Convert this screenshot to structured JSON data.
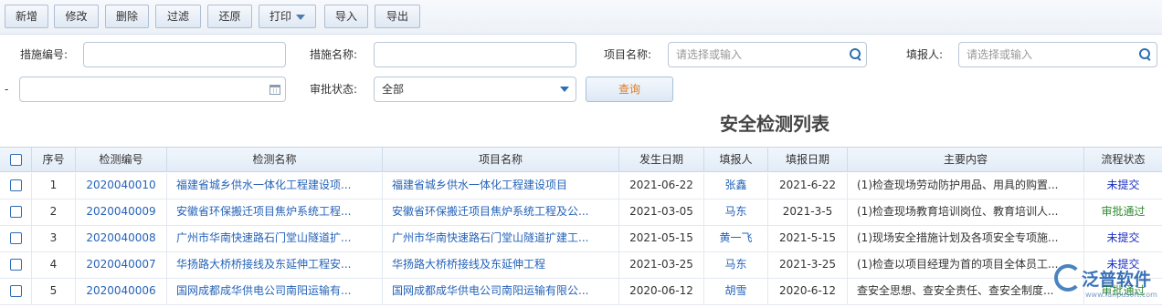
{
  "toolbar": {
    "add": "新增",
    "edit": "修改",
    "delete": "删除",
    "filter": "过滤",
    "restore": "还原",
    "print": "打印",
    "import": "导入",
    "export": "导出"
  },
  "filters": {
    "measure_no_label": "措施编号:",
    "measure_name_label": "措施名称:",
    "project_name_label": "项目名称:",
    "project_name_placeholder": "请选择或输入",
    "reporter_label": "填报人:",
    "reporter_placeholder": "请选择或输入",
    "range_dash": "-",
    "approval_label": "审批状态:",
    "approval_value": "全部",
    "query_button": "查询"
  },
  "page_title": "安全检测列表",
  "table": {
    "headers": [
      "序号",
      "检测编号",
      "检测名称",
      "项目名称",
      "发生日期",
      "填报人",
      "填报日期",
      "主要内容",
      "流程状态"
    ],
    "rows": [
      {
        "no": "1",
        "code": "2020040010",
        "name": "福建省城乡供水一体化工程建设项...",
        "project": "福建省城乡供水一体化工程建设项目",
        "date": "2021-06-22",
        "reporter": "张鑫",
        "fill_date": "2021-6-22",
        "content": "(1)检查现场劳动防护用品、用具的购置...",
        "status": "未提交",
        "status_color": "#1a2fbf"
      },
      {
        "no": "2",
        "code": "2020040009",
        "name": "安徽省环保搬迁项目焦炉系统工程...",
        "project": "安徽省环保搬迁项目焦炉系统工程及公...",
        "date": "2021-03-05",
        "reporter": "马东",
        "fill_date": "2021-3-5",
        "content": "(1)检查现场教育培训岗位、教育培训人...",
        "status": "审批通过",
        "status_color": "#2e8b2e"
      },
      {
        "no": "3",
        "code": "2020040008",
        "name": "广州市华南快速路石门堂山隧道扩...",
        "project": "广州市华南快速路石门堂山隧道扩建工...",
        "date": "2021-05-15",
        "reporter": "黄一飞",
        "fill_date": "2021-5-15",
        "content": "(1)现场安全措施计划及各项安全专项施...",
        "status": "未提交",
        "status_color": "#1a2fbf"
      },
      {
        "no": "4",
        "code": "2020040007",
        "name": "华扬路大桥桥接线及东延伸工程安...",
        "project": "华扬路大桥桥接线及东延伸工程",
        "date": "2021-03-25",
        "reporter": "马东",
        "fill_date": "2021-3-25",
        "content": "(1)检查以项目经理为首的项目全体员工...",
        "status": "未提交",
        "status_color": "#1a2fbf"
      },
      {
        "no": "5",
        "code": "2020040006",
        "name": "国网成都成华供电公司南阳运输有...",
        "project": "国网成都成华供电公司南阳运输有限公...",
        "date": "2020-06-12",
        "reporter": "胡雪",
        "fill_date": "2020-6-12",
        "content": "查安全思想、查安全责任、查安全制度...",
        "status": "审批通过",
        "status_color": "#2e8b2e"
      }
    ]
  },
  "watermark": {
    "brand": "泛普软件",
    "url": "www.fanpusoft.com"
  },
  "colors": {
    "link": "#2563b8",
    "accent": "#2b6fb5",
    "query_text": "#e07a1f"
  }
}
